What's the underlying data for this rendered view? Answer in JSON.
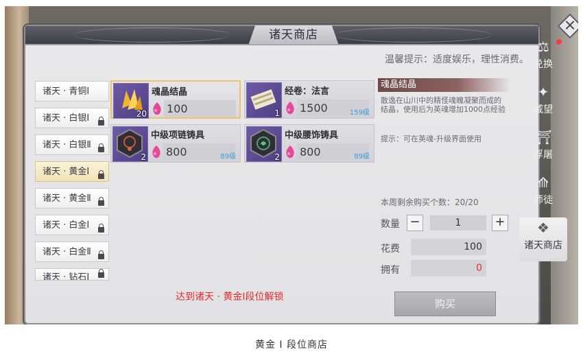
{
  "window": {
    "title": "诸天商店"
  },
  "tip": "温馨提示：适度娱乐，理性消费。",
  "tabs": [
    "诸天 · 青铜Ⅰ",
    "诸天 · 白银Ⅰ",
    "诸天 · 白银Ⅱ",
    "诸天 · 黄金Ⅰ",
    "诸天 · 黄金Ⅱ",
    "诸天 · 白金Ⅰ",
    "诸天 · 白金Ⅱ",
    "诸天 · 钻石Ⅰ"
  ],
  "items": [
    {
      "name": "魂晶结晶",
      "count": "20",
      "price": "100",
      "level": "",
      "icon": "crystal-icon"
    },
    {
      "name": "经卷：法言",
      "count": "1",
      "price": "1500",
      "level": "159级",
      "icon": "scroll-icon"
    },
    {
      "name": "中级项链铸具",
      "count": "2",
      "price": "800",
      "level": "89级",
      "icon": "necklace-mold-icon"
    },
    {
      "name": "中级腰饰铸具",
      "count": "2",
      "price": "800",
      "level": "89级",
      "icon": "waist-mold-icon"
    }
  ],
  "detail": {
    "title": "魂晶结晶",
    "description": "散逸在山川中的精怪魂魄凝聚而成的结晶，使用后为英魂增加1000点经验",
    "hint": "提示：可在英魂-升级界面使用",
    "weekly_remaining": "本周剩余购买个数：20/20",
    "quantity_label": "数量",
    "quantity": "1",
    "cost_label": "花费",
    "cost": "100",
    "own_label": "拥有",
    "own": "0"
  },
  "unlock_notice": "达到诸天 · 黄金Ⅰ段位解锁",
  "buy_button": "购买",
  "nav": [
    {
      "label": "兑换",
      "icon": "scales-icon"
    },
    {
      "label": "威望",
      "icon": "winged-emblem-icon"
    },
    {
      "label": "浮屠",
      "icon": "pagoda-icon"
    },
    {
      "label": "师徒",
      "icon": "mentor-icon"
    },
    {
      "label": "诸天商店",
      "icon": "shop-emblem-icon"
    }
  ],
  "caption": "黄金 I 段位商店",
  "colors": {
    "accent_red": "#e22c2c",
    "level_blue": "#3aa0d8",
    "selected_gold": "#e9c46b"
  }
}
